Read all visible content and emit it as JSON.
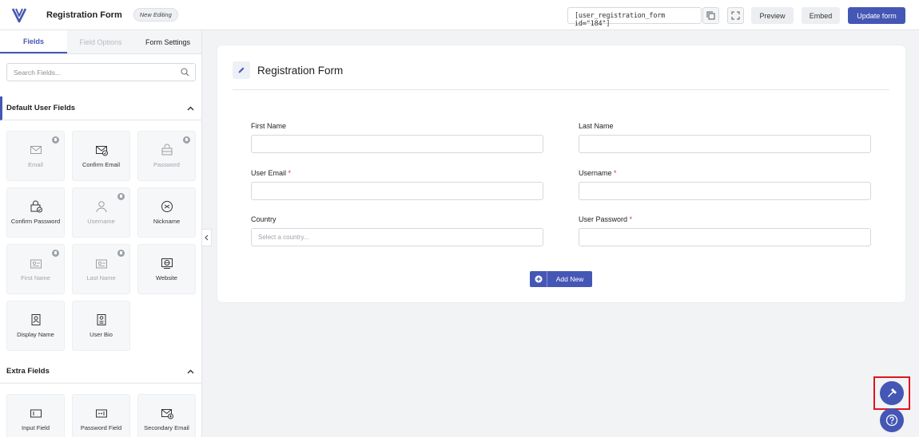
{
  "header": {
    "form_title": "Registration Form",
    "badge": "New Editing",
    "shortcode": "[user_registration_form id=\"184\"]",
    "preview_label": "Preview",
    "embed_label": "Embed",
    "update_label": "Update form",
    "accent_color": "#4557b5"
  },
  "sidebar": {
    "tabs": [
      "Fields",
      "Field Options",
      "Form Settings"
    ],
    "search_placeholder": "Search Fields...",
    "default_section_title": "Default User Fields",
    "default_fields": [
      {
        "label": "Email",
        "icon": "email-icon",
        "locked": true
      },
      {
        "label": "Confirm Email",
        "icon": "confirm-email-icon",
        "locked": false
      },
      {
        "label": "Password",
        "icon": "password-icon",
        "locked": true
      },
      {
        "label": "Confirm Password",
        "icon": "confirm-password-icon",
        "locked": false
      },
      {
        "label": "Username",
        "icon": "user-icon",
        "locked": true
      },
      {
        "label": "Nickname",
        "icon": "nickname-icon",
        "locked": false
      },
      {
        "label": "First Name",
        "icon": "first-name-icon",
        "locked": true
      },
      {
        "label": "Last Name",
        "icon": "last-name-icon",
        "locked": true
      },
      {
        "label": "Website",
        "icon": "website-icon",
        "locked": false
      },
      {
        "label": "Display Name",
        "icon": "display-name-icon",
        "locked": false
      },
      {
        "label": "User Bio",
        "icon": "user-bio-icon",
        "locked": false
      }
    ],
    "extra_section_title": "Extra Fields",
    "extra_fields": [
      {
        "label": "Input Field",
        "icon": "input-field-icon"
      },
      {
        "label": "Password Field",
        "icon": "password-field-icon"
      },
      {
        "label": "Secondary Email",
        "icon": "secondary-email-icon"
      }
    ]
  },
  "form": {
    "title": "Registration Form",
    "fields": [
      {
        "label": "First Name",
        "required": false,
        "placeholder": ""
      },
      {
        "label": "Last Name",
        "required": false,
        "placeholder": ""
      },
      {
        "label": "User Email",
        "required": true,
        "placeholder": ""
      },
      {
        "label": "Username",
        "required": true,
        "placeholder": ""
      },
      {
        "label": "Country",
        "required": false,
        "placeholder": "Select a country..."
      },
      {
        "label": "User Password",
        "required": true,
        "placeholder": ""
      }
    ],
    "required_mark": "*",
    "add_new_label": "Add New"
  }
}
